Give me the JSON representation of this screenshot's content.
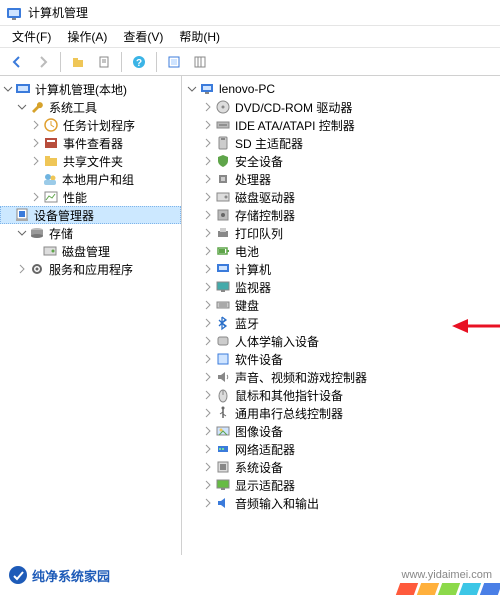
{
  "window": {
    "title": "计算机管理"
  },
  "menu": {
    "file": "文件(F)",
    "action": "操作(A)",
    "view": "查看(V)",
    "help": "帮助(H)"
  },
  "toolbar": {
    "back": "后退",
    "forward": "前进",
    "up": "上移",
    "props": "属性",
    "help": "帮助",
    "refresh": "刷新",
    "cols": "列"
  },
  "leftTree": {
    "root": "计算机管理(本地)",
    "sysTools": "系统工具",
    "taskSched": "任务计划程序",
    "eventViewer": "事件查看器",
    "sharedFolders": "共享文件夹",
    "localUsers": "本地用户和组",
    "perf": "性能",
    "devmgr": "设备管理器",
    "storage": "存储",
    "diskMgmt": "磁盘管理",
    "services": "服务和应用程序"
  },
  "rightTree": {
    "host": "lenovo-PC",
    "items": [
      {
        "label": "DVD/CD-ROM 驱动器",
        "icon": "optical"
      },
      {
        "label": "IDE ATA/ATAPI 控制器",
        "icon": "ide"
      },
      {
        "label": "SD 主适配器",
        "icon": "sd"
      },
      {
        "label": "安全设备",
        "icon": "security"
      },
      {
        "label": "处理器",
        "icon": "cpu"
      },
      {
        "label": "磁盘驱动器",
        "icon": "disk"
      },
      {
        "label": "存储控制器",
        "icon": "storage"
      },
      {
        "label": "打印队列",
        "icon": "printer"
      },
      {
        "label": "电池",
        "icon": "battery"
      },
      {
        "label": "计算机",
        "icon": "computer"
      },
      {
        "label": "监视器",
        "icon": "monitor"
      },
      {
        "label": "键盘",
        "icon": "keyboard"
      },
      {
        "label": "蓝牙",
        "icon": "bluetooth"
      },
      {
        "label": "人体学输入设备",
        "icon": "hid"
      },
      {
        "label": "软件设备",
        "icon": "software"
      },
      {
        "label": "声音、视频和游戏控制器",
        "icon": "sound"
      },
      {
        "label": "鼠标和其他指针设备",
        "icon": "mouse"
      },
      {
        "label": "通用串行总线控制器",
        "icon": "usb"
      },
      {
        "label": "图像设备",
        "icon": "image"
      },
      {
        "label": "网络适配器",
        "icon": "network"
      },
      {
        "label": "系统设备",
        "icon": "system"
      },
      {
        "label": "显示适配器",
        "icon": "display"
      },
      {
        "label": "音频输入和输出",
        "icon": "audio"
      }
    ]
  },
  "footer": {
    "brand": "纯净系统家园",
    "url": "www.yidaimei.com"
  },
  "icons": {
    "computer-mgmt": "#2a6fc9",
    "wrench": "#d6a22b",
    "clock": "#e0a030",
    "event": "#b84d3c",
    "folder": "#efc657",
    "users": "#6fb4e0",
    "perf": "#5fa54a",
    "devmgr": "#3b7bdb",
    "storage": "#6b6b6b",
    "disk": "#7a7a7a",
    "services": "#5a5a5a"
  }
}
